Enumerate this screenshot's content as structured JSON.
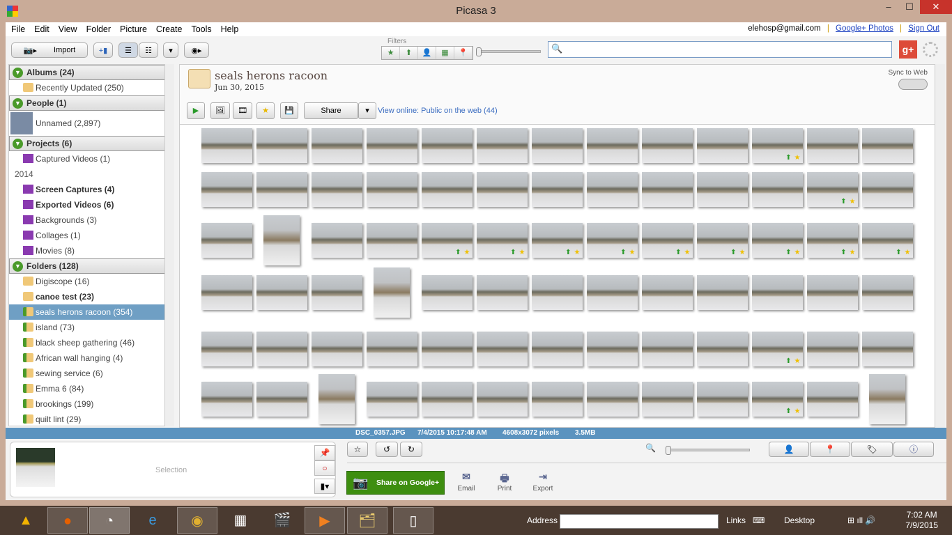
{
  "window": {
    "title": "Picasa 3",
    "minimize": "–",
    "maximize": "☐",
    "close": "✕"
  },
  "menu": [
    "File",
    "Edit",
    "View",
    "Folder",
    "Picture",
    "Create",
    "Tools",
    "Help"
  ],
  "account": {
    "email": "elehosp@gmail.com",
    "google_photos": "Google+ Photos",
    "separator": "|",
    "sign_out": "Sign Out"
  },
  "toolbar": {
    "import": "Import",
    "filters_label": "Filters",
    "filters": [
      "★",
      "⬆",
      "👤",
      "▦",
      "📍"
    ],
    "search_placeholder": ""
  },
  "sidebar": {
    "albums": {
      "title": "Albums (24)",
      "items": [
        {
          "label": "Recently Updated (250)"
        }
      ]
    },
    "people": {
      "title": "People (1)",
      "items": [
        {
          "label": "Unnamed (2,897)"
        }
      ]
    },
    "projects": {
      "title": "Projects (6)",
      "items": [
        {
          "label": "Captured Videos (1)"
        }
      ],
      "year": "2014",
      "year_items": [
        {
          "label": "Screen Captures (4)",
          "bold": true
        },
        {
          "label": "Exported Videos (6)",
          "bold": true
        },
        {
          "label": "Backgrounds (3)"
        },
        {
          "label": "Collages (1)"
        },
        {
          "label": "Movies (8)"
        }
      ]
    },
    "folders": {
      "title": "Folders (128)",
      "items": [
        {
          "label": "Digiscope (16)",
          "icon": "folder"
        },
        {
          "label": "canoe test (23)",
          "icon": "folder",
          "bold": true
        },
        {
          "label": "seals herons racoon (354)",
          "icon": "upload-folder",
          "selected": true
        },
        {
          "label": "island (73)",
          "icon": "upload-folder"
        },
        {
          "label": "black sheep gathering (46)",
          "icon": "upload-folder"
        },
        {
          "label": "African wall hanging (4)",
          "icon": "upload-folder"
        },
        {
          "label": "sewing service (6)",
          "icon": "upload-folder"
        },
        {
          "label": "Emma 6 (84)",
          "icon": "upload-folder"
        },
        {
          "label": "brookings (199)",
          "icon": "upload-folder"
        },
        {
          "label": "quilt lint (29)",
          "icon": "upload-folder"
        }
      ]
    }
  },
  "album": {
    "title": "seals herons racoon",
    "date": "Jun 30, 2015",
    "share": "Share",
    "view_online": "View online: Public on the web (44)",
    "sync": "Sync to Web"
  },
  "photos": [
    [
      "",
      "",
      "",
      "",
      "",
      "",
      "",
      "",
      "",
      "",
      "us",
      "",
      ""
    ],
    [
      "",
      "",
      "",
      "",
      "",
      "",
      "",
      "",
      "",
      "",
      "",
      "us",
      ""
    ],
    [
      "",
      "p",
      "",
      "",
      "us",
      "us",
      "us",
      "us",
      "us",
      "us",
      "us",
      "us",
      "us"
    ],
    [
      "",
      "",
      "",
      "p",
      "",
      "",
      "",
      "",
      "",
      "",
      "",
      "",
      ""
    ],
    [
      "",
      "",
      "",
      "",
      "",
      "",
      "",
      "",
      "",
      "",
      "us",
      "",
      ""
    ],
    [
      "",
      "",
      "p",
      "",
      "",
      "",
      "",
      "",
      "",
      "",
      "us",
      "",
      "p"
    ]
  ],
  "status": {
    "filename": "DSC_0357.JPG",
    "datetime": "7/4/2015 10:17:48 AM",
    "dimensions": "4608x3072 pixels",
    "size": "3.5MB"
  },
  "tray": {
    "selection": "Selection"
  },
  "actions": {
    "share_google": "Share on Google+",
    "email": "Email",
    "print": "Print",
    "export": "Export"
  },
  "taskbar": {
    "address": "Address",
    "links": "Links",
    "desktop": "Desktop",
    "time": "7:02 AM",
    "date": "7/9/2015"
  },
  "colors": {
    "status_bar": "#5b93bf",
    "share_green": "#3e8e10",
    "selected": "#6f9fc4"
  }
}
